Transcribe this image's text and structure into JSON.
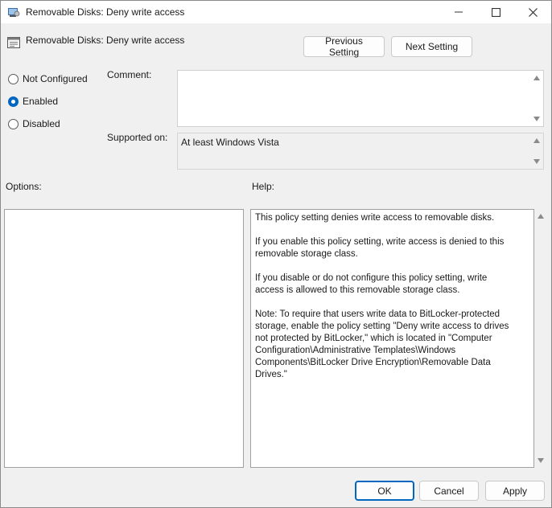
{
  "window": {
    "title": "Removable Disks: Deny write access",
    "controls": {
      "minimize": "minimize",
      "maximize": "maximize",
      "close": "close"
    }
  },
  "header": {
    "title": "Removable Disks: Deny write access",
    "prev_button": "Previous Setting",
    "next_button": "Next Setting"
  },
  "state": {
    "options": [
      {
        "label": "Not Configured",
        "checked": false
      },
      {
        "label": "Enabled",
        "checked": true
      },
      {
        "label": "Disabled",
        "checked": false
      }
    ]
  },
  "comment": {
    "label": "Comment:",
    "value": ""
  },
  "supported": {
    "label": "Supported on:",
    "value": "At least Windows Vista"
  },
  "options_section": {
    "label": "Options:"
  },
  "help_section": {
    "label": "Help:",
    "paragraphs": [
      "This policy setting denies write access to removable disks.",
      "If you enable this policy setting, write access is denied to this removable storage class.",
      "If you disable or do not configure this policy setting, write access is allowed to this removable storage class.",
      "Note: To require that users write data to BitLocker-protected storage, enable the policy setting \"Deny write access to drives not protected by BitLocker,\" which is located in \"Computer Configuration\\Administrative Templates\\Windows Components\\BitLocker Drive Encryption\\Removable Data Drives.\""
    ]
  },
  "footer": {
    "ok": "OK",
    "cancel": "Cancel",
    "apply": "Apply"
  },
  "colors": {
    "accent": "#0067c0",
    "background": "#f0f0f0"
  }
}
